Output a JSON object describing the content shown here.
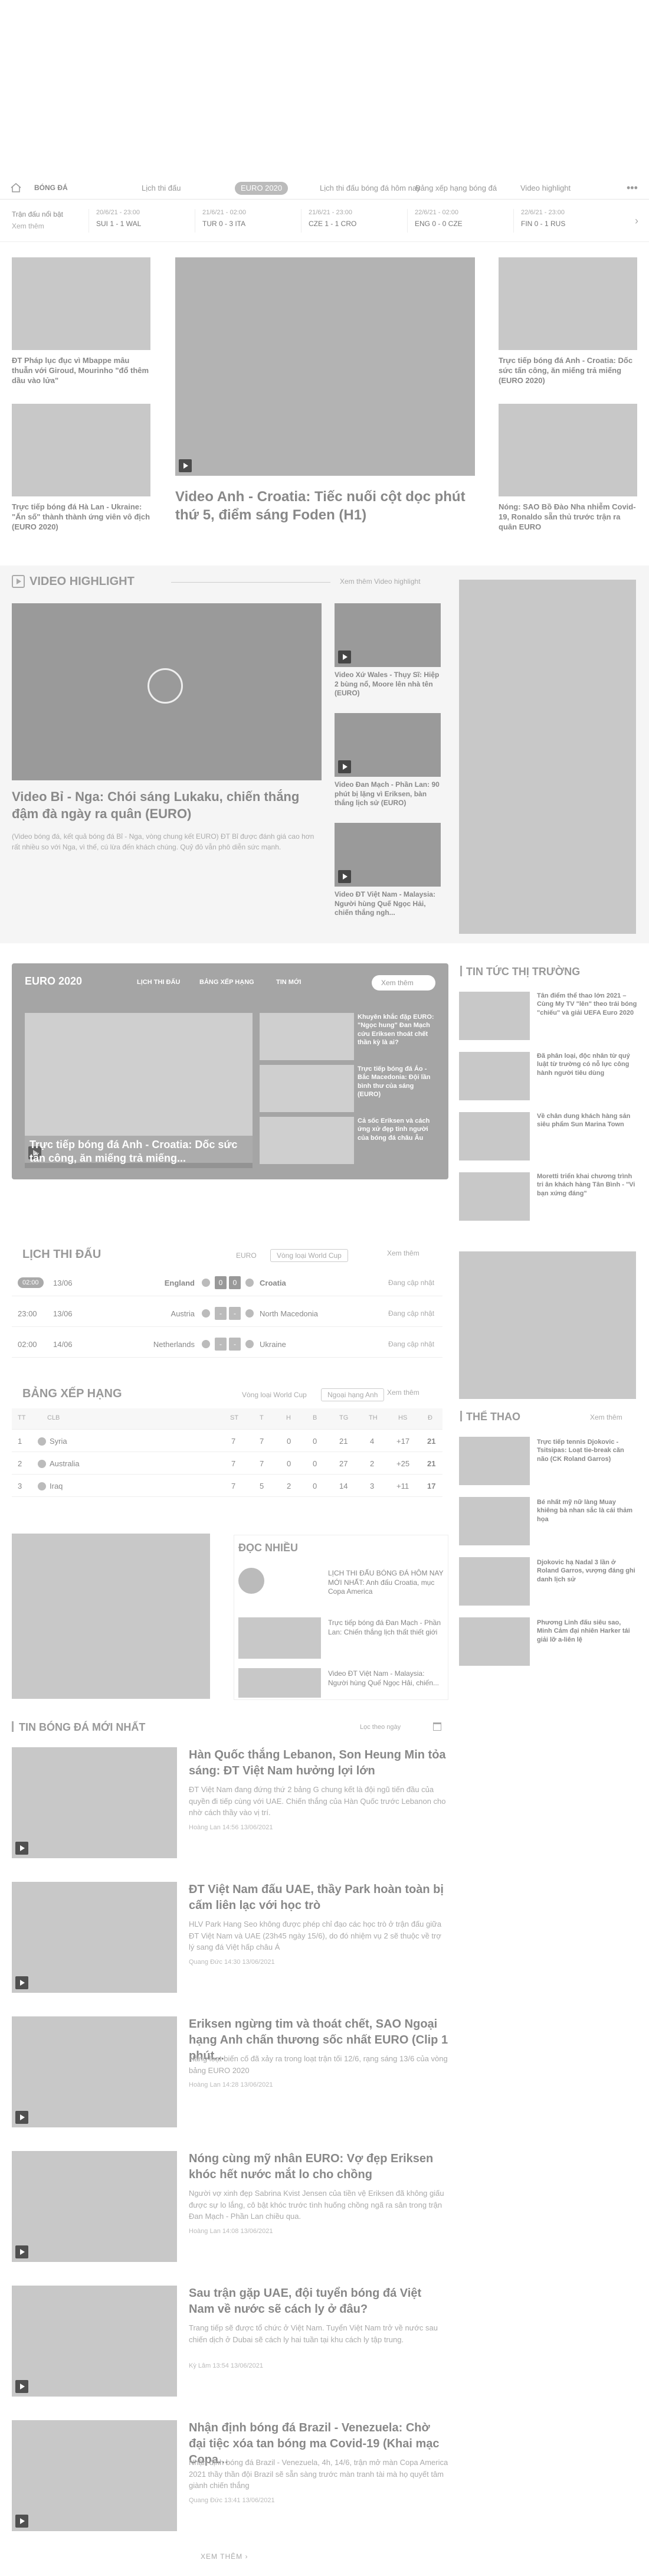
{
  "nav": {
    "items": [
      "BÓNG ĐÁ",
      "Lịch thi đấu",
      "EURO 2020",
      "Lịch thi đấu bóng đá hôm nay",
      "Bảng xếp hạng bóng đá",
      "Video highlight"
    ]
  },
  "scores": {
    "label": "Trận đấu nổi bật",
    "more": "Xem thêm",
    "matches": [
      {
        "time": "20/6/21 - 23:00",
        "score": "SUI 1 - 1 WAL"
      },
      {
        "time": "21/6/21 - 02:00",
        "score": "TUR 0 - 3 ITA"
      },
      {
        "time": "21/6/21 - 23:00",
        "score": "CZE 1 - 1 CRO"
      },
      {
        "time": "22/6/21 - 02:00",
        "score": "ENG 0 - 0 CZE"
      },
      {
        "time": "22/6/21 - 23:00",
        "score": "FIN 0 - 1 RUS"
      }
    ]
  },
  "top": {
    "left": [
      {
        "title": "ĐT Pháp lục đục vì Mbappe mâu thuẫn với Giroud, Mourinho \"đổ thêm dầu vào lửa\""
      },
      {
        "title": "Trực tiếp bóng đá Hà Lan - Ukraine: \"Ấn số\" thành thành ứng viên vô địch (EURO 2020)"
      }
    ],
    "main": {
      "title": "Video Anh - Croatia: Tiếc nuối cột dọc phút thứ 5, điểm sáng Foden (H1)"
    },
    "right": [
      {
        "title": "Trực tiếp bóng đá Anh - Croatia: Dốc sức tấn công, ăn miếng trả miếng (EURO 2020)"
      },
      {
        "title": "Nóng: SAO Bồ Đào Nha nhiễm Covid-19, Ronaldo sẵn thủ trước trận ra quân EURO"
      }
    ]
  },
  "video": {
    "heading": "VIDEO HIGHLIGHT",
    "more": "Xem thêm Video highlight",
    "main_title": "Video Bỉ - Nga: Chói sáng Lukaku, chiến thắng đậm đà ngày ra quân (EURO)",
    "main_desc": "(Video bóng đá, kết quả bóng đá Bỉ - Nga, vòng chung kết EURO) ĐT Bỉ được đánh giá cao hơn rất nhiều so với Nga, vì thế, cú lừa đến khách chúng. Quỷ đỏ vẫn phô diễn sức mạnh.",
    "side": [
      {
        "title": "Video Xứ Wales - Thụy Sĩ: Hiệp 2 bùng nổ, Moore lên nhà tên (EURO)"
      },
      {
        "title": "Video Đan Mạch - Phần Lan: 90 phút bị lặng vì Eriksen, bàn thắng lịch sử (EURO)"
      },
      {
        "title": "Video ĐT Việt Nam - Malaysia: Người hùng Quế Ngọc Hải, chiến thắng ngh..."
      }
    ]
  },
  "euro": {
    "logo": "EURO 2020",
    "tabs": [
      "LỊCH THI ĐẤU",
      "BẢNG XẾP HẠNG",
      "TIN MỚI"
    ],
    "more": "Xem thêm",
    "main_title": "Trực tiếp bóng đá Anh - Croatia: Dốc sức tấn công, ăn miếng trả miếng...",
    "side": [
      {
        "title": "Khuyên khắc đặp EURO: \"Ngọc hung\" Đan Mạch cứu Eriksen thoát chết thần kỳ là ai?"
      },
      {
        "title": "Trực tiếp bóng đá Áo - Bắc Macedonia: Đội lần bình thư của sáng (EURO)"
      },
      {
        "title": "Cả sốc Eriksen và cách ứng xử đẹp tinh người của bóng đá châu Âu"
      }
    ]
  },
  "market": {
    "heading": "TIN TỨC THỊ TRƯỜNG",
    "items": [
      {
        "title": "Tân điểm thể thao lớn 2021 – Cùng My TV \"lên\" theo trái bóng \"chiếu\" và giải UEFA Euro 2020"
      },
      {
        "title": "Đã phân loại, độc nhân từ quý luật từ trường có nỗ lực công hành người tiêu dùng"
      },
      {
        "title": "Về chân dung khách hàng sản siêu phẩm Sun Marina Town"
      },
      {
        "title": "Moretti triển khai chương trình tri ân khách hàng Tân Bình - \"Vi bạn xứng đáng\""
      }
    ]
  },
  "fixtures": {
    "heading": "LỊCH THI ĐẤU",
    "tabs": [
      "EURO",
      "Vòng loại World Cup"
    ],
    "more": "Xem thêm",
    "rows": [
      {
        "time": "02:00",
        "date": "13/06",
        "home": "England",
        "hs": "0",
        "as": "0",
        "away": "Croatia",
        "status": "Đang cập nhật"
      },
      {
        "time": "23:00",
        "date": "13/06",
        "home": "Austria",
        "hs": "-",
        "as": "-",
        "away": "North Macedonia",
        "status": "Đang cập nhật"
      },
      {
        "time": "02:00",
        "date": "14/06",
        "home": "Netherlands",
        "hs": "-",
        "as": "-",
        "away": "Ukraine",
        "status": "Đang cập nhật"
      }
    ]
  },
  "standings": {
    "heading": "BẢNG XẾP HẠNG",
    "tabs": [
      "Vòng loại World Cup",
      "Ngoại hạng Anh"
    ],
    "more": "Xem thêm",
    "cols": [
      "TT",
      "CLB",
      "ST",
      "T",
      "H",
      "B",
      "TG",
      "TH",
      "HS",
      "Đ"
    ],
    "rows": [
      {
        "tt": "1",
        "name": "Syria",
        "st": "7",
        "t": "7",
        "h": "0",
        "b": "0",
        "tg": "21",
        "th": "4",
        "hs": "+17",
        "d": "21"
      },
      {
        "tt": "2",
        "name": "Australia",
        "st": "7",
        "t": "7",
        "h": "0",
        "b": "0",
        "tg": "27",
        "th": "2",
        "hs": "+25",
        "d": "21"
      },
      {
        "tt": "3",
        "name": "Iraq",
        "st": "7",
        "t": "5",
        "h": "2",
        "b": "0",
        "tg": "14",
        "th": "3",
        "hs": "+11",
        "d": "17"
      }
    ]
  },
  "sport": {
    "heading": "THỂ THAO",
    "more": "Xem thêm",
    "items": [
      {
        "title": "Trực tiếp tennis Djokovic - Tsitsipas: Loạt tie-break căn não (CK Roland Garros)"
      },
      {
        "title": "Bé nhất mỹ nữ làng Muay khiêng bà nhan sắc là cái thảm họa"
      },
      {
        "title": "Djokovic hạ Nadal 3 lần ở Roland Garros, vượng đáng ghi danh lịch sử"
      },
      {
        "title": "Phương Linh đấu siêu sao, Minh Cảm đại nhiên Harker tái giải lỡ a-liên lệ"
      }
    ]
  },
  "popular": {
    "heading": "ĐỌC NHIỀU",
    "items": [
      {
        "title": "LỊCH THI ĐẤU BÓNG ĐÁ HÔM NAY MỚI NHẤT: Anh đấu Croatia, mục Copa America"
      },
      {
        "title": "Trực tiếp bóng đá Đan Mạch - Phần Lan: Chiến thắng lịch thất thiết giới"
      },
      {
        "title": "Video ĐT Việt Nam - Malaysia: Người hùng Quế Ngọc Hải, chiến..."
      }
    ]
  },
  "latest": {
    "heading": "TIN BÓNG ĐÁ MỚI NHẤT",
    "filter": "Lọc theo ngày",
    "items": [
      {
        "title": "Hàn Quốc thắng Lebanon, Son Heung Min tỏa sáng: ĐT Việt Nam hưởng lợi lớn",
        "desc": "ĐT Việt Nam đang đứng thứ 2 bảng G chung kết là đội ngũ tiến đầu của quyền đi tiếp cùng với UAE. Chiến thắng của Hàn Quốc trước Lebanon cho nhờ cách thầy vào vị trí.",
        "meta": "Hoàng Lan 14:56 13/06/2021"
      },
      {
        "title": "ĐT Việt Nam đấu UAE, thầy Park hoàn toàn bị cấm liên lạc với học trò",
        "desc": "HLV Park Hang Seo không được phép chỉ đạo các học trò ở trận đấu giữa ĐT Việt Nam và UAE (23h45 ngày 15/6), do đó nhiệm vụ 2 sẽ thuộc về trợ lý sang đá Việt hấp châu Á",
        "meta": "Quang Đức 14:30 13/06/2021"
      },
      {
        "title": "Eriksen ngừng tim và thoát chết, SAO Ngoại hạng Anh chấn thương sốc nhất EURO (Clip 1 phút...",
        "desc": "Hàng loạt biến cố đã xảy ra trong loạt trận tối 12/6, rạng sáng 13/6 của vòng bảng EURO 2020",
        "meta": "Hoàng Lan 14:28 13/06/2021"
      },
      {
        "title": "Nóng cùng mỹ nhân EURO: Vợ đẹp Eriksen khóc hết nước mắt lo cho chồng",
        "desc": "Người vợ xinh đẹp Sabrina Kvist Jensen của tiền vệ Eriksen đã không giấu được sự lo lắng, cô bật khóc trước tình huống chồng ngã ra sân trong trận Đan Mạch - Phần Lan chiều qua.",
        "meta": "Hoàng Lan 14:08 13/06/2021"
      },
      {
        "title": "Sau trận gặp UAE, đội tuyển bóng đá Việt Nam về nước sẽ cách ly ở đâu?",
        "desc": "Trang tiếp sẽ được tổ chức ở Việt Nam. Tuyển Việt Nam trở về nước sau chiến dịch ở Dubai sẽ cách ly hai tuần tại khu cách ly tập trung.",
        "meta": "Kỳ Lâm 13:54 13/06/2021"
      },
      {
        "title": "Nhận định bóng đá Brazil - Venezuela: Chờ đại tiệc xóa tan bóng ma Covid-19 (Khai mạc Copa...",
        "desc": "Nhận định bóng đá Brazil - Venezuela, 4h, 14/6, trận mở màn Copa America 2021 thầy thần đội Brazil sẽ sẵn sàng trước màn tranh tài mà họ quyết tâm giành chiến thắng",
        "meta": "Quang Đức 13:41 13/06/2021"
      }
    ],
    "more": "XEM THÊM"
  }
}
